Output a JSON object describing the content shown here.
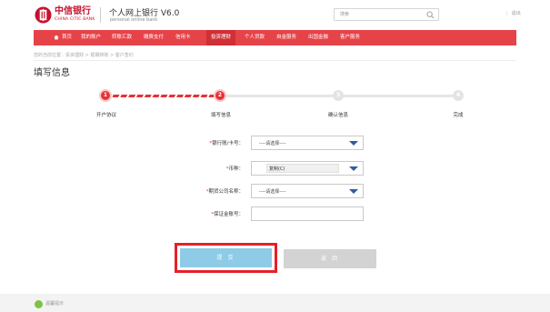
{
  "header": {
    "brand_cn": "中信银行",
    "brand_en": "CHINA CITIC BANK",
    "site_title": "个人网上银行 V6.0",
    "site_subtitle": "personal online bank",
    "search_placeholder": "搜索",
    "help": "退出"
  },
  "nav": {
    "items": [
      {
        "label": "首页"
      },
      {
        "label": "我的账户"
      },
      {
        "label": "转账汇款"
      },
      {
        "label": "缴费支付"
      },
      {
        "label": "信用卡"
      },
      {
        "label": "投资理财"
      },
      {
        "label": "个人贷款"
      },
      {
        "label": "自金服务"
      },
      {
        "label": "出国金融"
      },
      {
        "label": "客户服务"
      }
    ],
    "active_index": 5,
    "bg_color": "#e64349"
  },
  "breadcrumb": "您的当前位置：投资理财 > 银期转账 > 客户签约",
  "page_title": "填写信息",
  "steps": [
    {
      "num": "1",
      "label": "开户协议",
      "state": "done"
    },
    {
      "num": "2",
      "label": "填写信息",
      "state": "current"
    },
    {
      "num": "3",
      "label": "确认信息",
      "state": "todo"
    },
    {
      "num": "4",
      "label": "完成",
      "state": "todo"
    }
  ],
  "form": {
    "bank_account": {
      "label": "银行账/卡号：",
      "value": "----请选择----"
    },
    "currency": {
      "label": "币种：",
      "value": "复制(C)"
    },
    "futures_company": {
      "label": "期货公司名称：",
      "value": "----请选择----"
    },
    "margin_account": {
      "label": "保证金账号：",
      "value": ""
    }
  },
  "buttons": {
    "submit": "提 交",
    "back": "返 回"
  },
  "footer": {
    "text": "温馨提示"
  },
  "colors": {
    "brand_red": "#c8102e",
    "step_red": "#e63238",
    "submit_blue": "#8ecbe7",
    "highlight_frame": "#e61f28"
  }
}
